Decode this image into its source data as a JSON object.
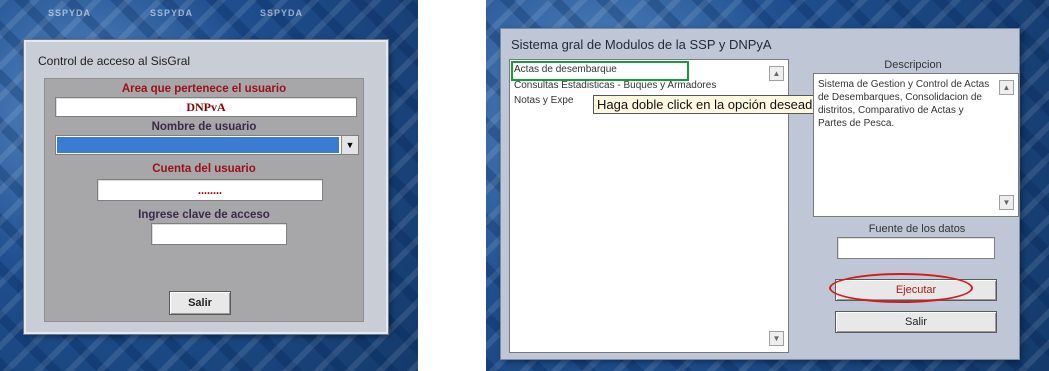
{
  "left_panel": {
    "background_tag": "SSPYDA",
    "dialog": {
      "title": "Control de acceso al SisGral",
      "area_label": "Area que pertenece el usuario",
      "area_value": "DNPvA",
      "username_label": "Nombre de usuario",
      "username_value": "",
      "account_label": "Cuenta del usuario",
      "account_value": "........",
      "password_label": "Ingrese clave de acceso",
      "password_value": "",
      "exit_button": "Salir"
    }
  },
  "right_panel": {
    "title": "Sistema gral de Modulos de la SSP y DNPyA",
    "modules": [
      "Actas de desembarque",
      "Consultas Estadisticas - Buques y Armadores",
      "Notas y Expe"
    ],
    "tooltip": "Haga doble click en la opción deseada",
    "description_label": "Descripcion",
    "description_text": "Sistema de Gestion y Control de Actas de Desembarques, Consolidacion de distritos, Comparativo de Actas y Partes de Pesca.",
    "source_label": "Fuente de los datos",
    "source_value": "",
    "execute_button": "Ejecutar",
    "exit_button": "Salir"
  },
  "colors": {
    "background_blue": "#1f4f8f",
    "dialog_gray": "#c9cdd6",
    "label_red": "#9b0f1b",
    "selection_blue": "#3a7bd5",
    "highlight_green": "#1a9a3a",
    "highlight_red": "#d21a1a"
  }
}
